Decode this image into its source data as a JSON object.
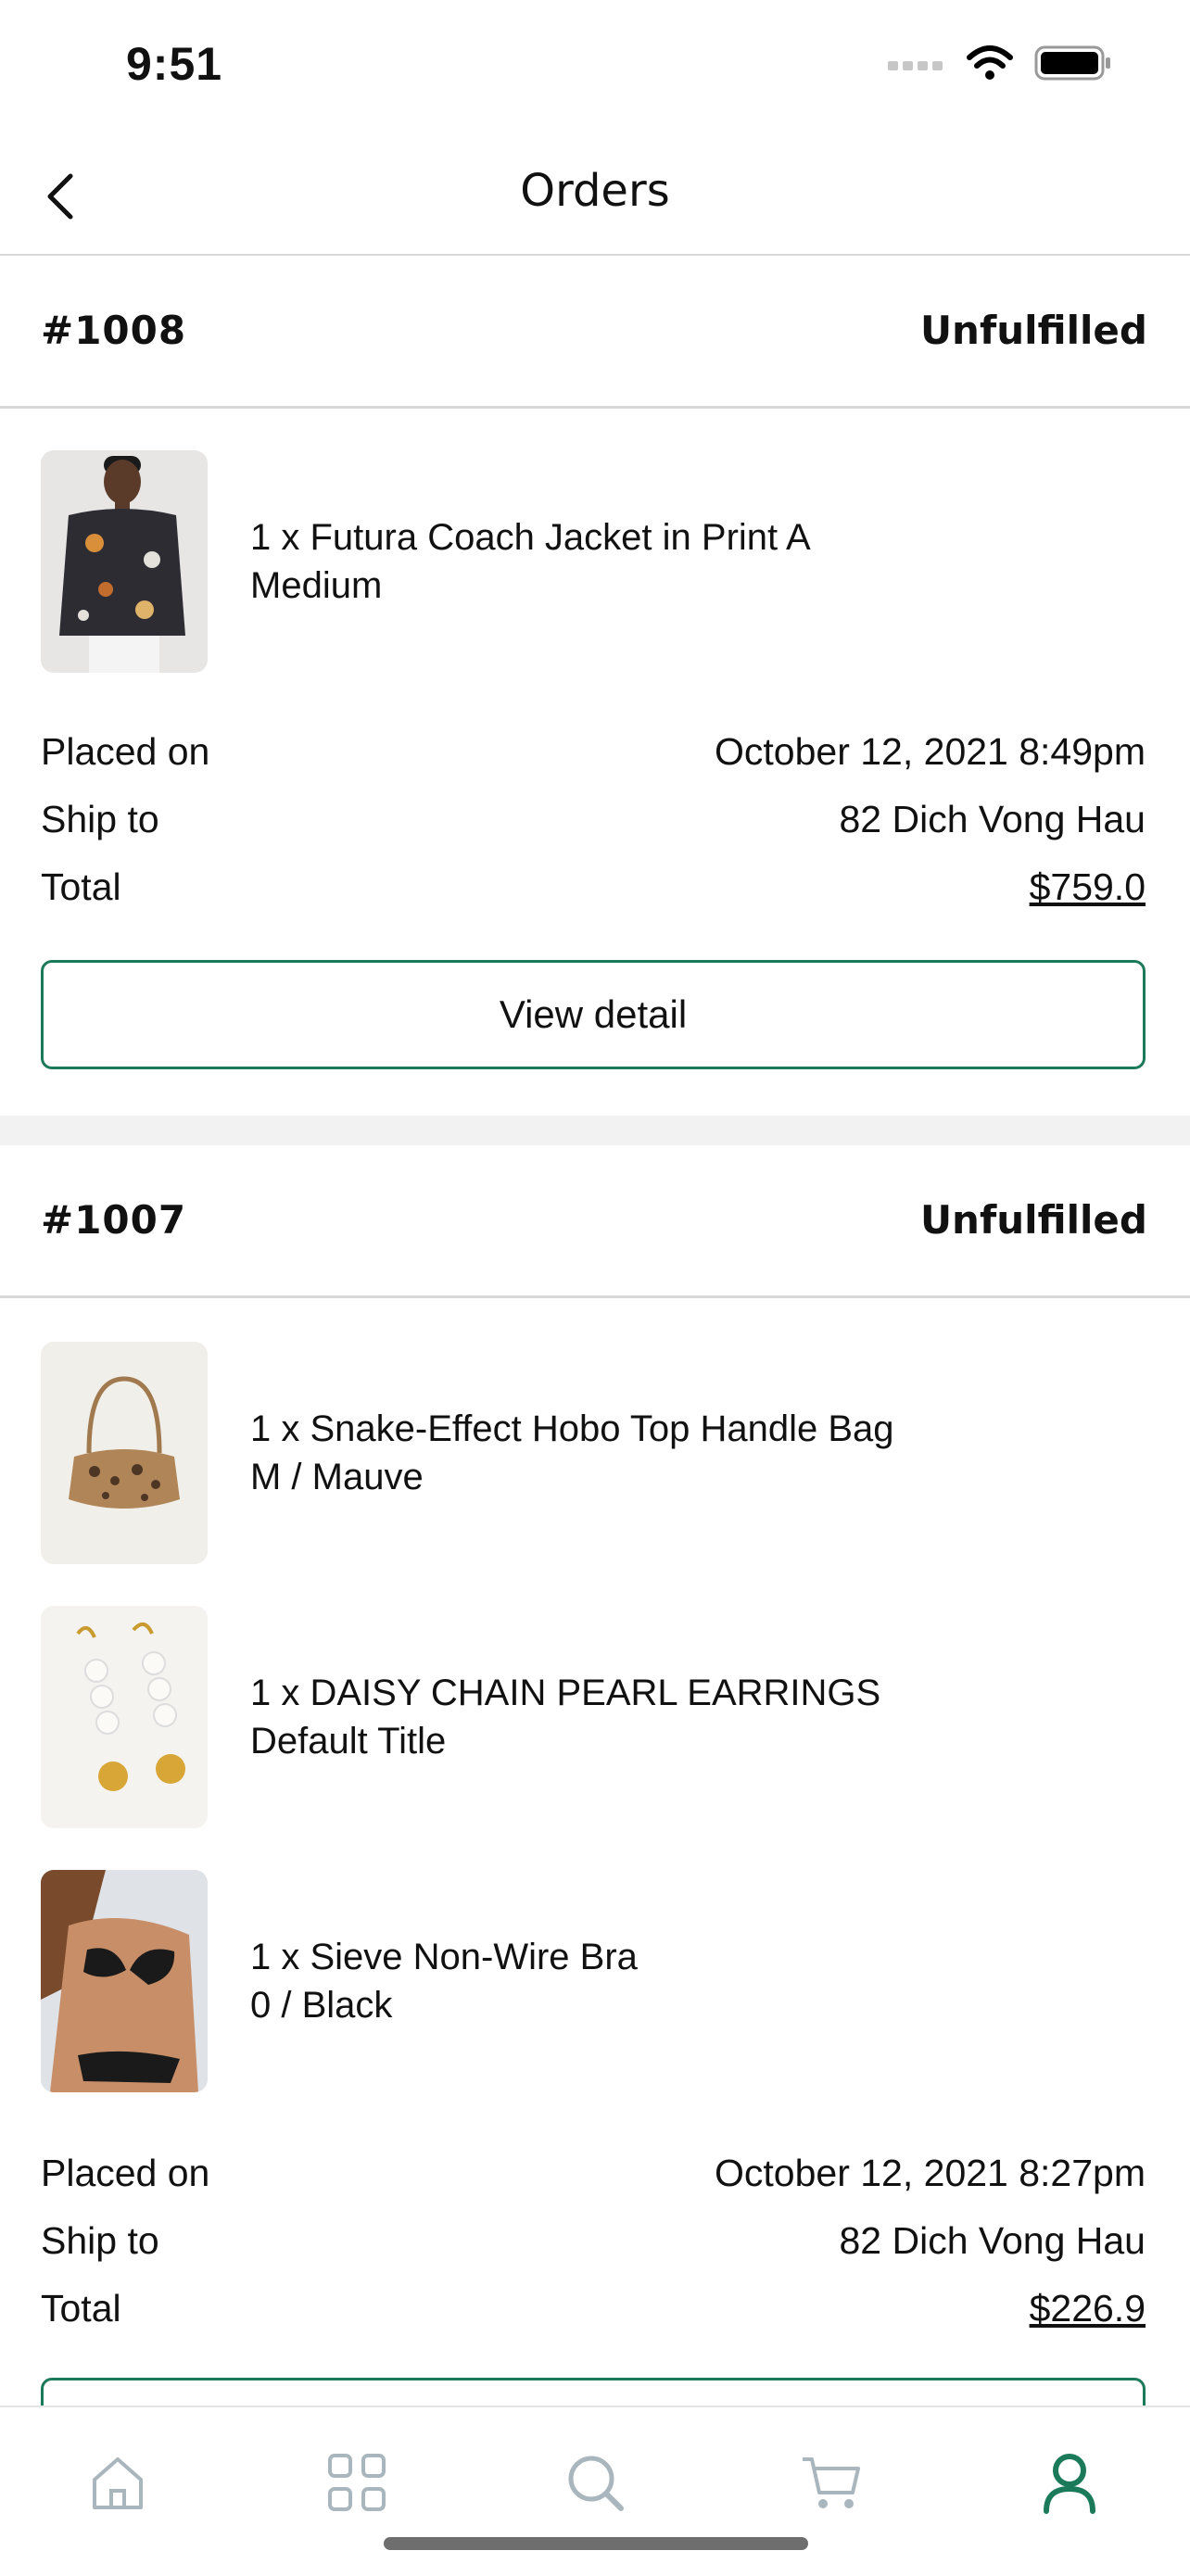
{
  "status_bar": {
    "time": "9:51"
  },
  "nav": {
    "title": "Orders"
  },
  "labels": {
    "placed_on": "Placed on",
    "ship_to": "Ship to",
    "total": "Total",
    "view_detail": "View detail"
  },
  "orders": [
    {
      "number": "#1008",
      "status": "Unfulfilled",
      "items": [
        {
          "line1": "1 x Futura Coach Jacket in Print A",
          "line2": "Medium",
          "image": "jacket-photo"
        }
      ],
      "placed_on": "October 12, 2021 8:49pm",
      "ship_to": "82 Dich Vong Hau",
      "total": "$759.0"
    },
    {
      "number": "#1007",
      "status": "Unfulfilled",
      "items": [
        {
          "line1": "1 x Snake-Effect Hobo Top Handle Bag",
          "line2": "M / Mauve",
          "image": "bag-photo"
        },
        {
          "line1": "1 x DAISY CHAIN PEARL EARRINGS",
          "line2": "Default Title",
          "image": "earrings-photo"
        },
        {
          "line1": "1 x Sieve Non-Wire Bra",
          "line2": "0 / Black",
          "image": "bra-photo"
        }
      ],
      "placed_on": "October 12, 2021 8:27pm",
      "ship_to": "82 Dich Vong Hau",
      "total": "$226.9"
    }
  ],
  "tab_bar": {
    "tabs": [
      {
        "icon": "home-icon",
        "active": false
      },
      {
        "icon": "grid-icon",
        "active": false
      },
      {
        "icon": "search-icon",
        "active": false
      },
      {
        "icon": "cart-icon",
        "active": false
      },
      {
        "icon": "user-icon",
        "active": true
      }
    ],
    "active_color": "#1b7a5a",
    "inactive_color": "#a9b6bd"
  },
  "colors": {
    "accent": "#1b7a5a"
  }
}
